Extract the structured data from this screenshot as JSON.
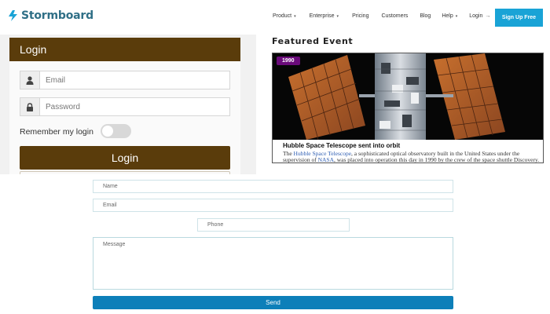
{
  "nav": {
    "logo_text": "Stormboard",
    "links": [
      {
        "label": "Product",
        "caret": "▾"
      },
      {
        "label": "Enterprise",
        "caret": "▾"
      },
      {
        "label": "Pricing",
        "caret": ""
      },
      {
        "label": "Customers",
        "caret": ""
      },
      {
        "label": "Blog",
        "caret": ""
      },
      {
        "label": "Help",
        "caret": "▾"
      },
      {
        "label": "Login",
        "caret": "→"
      }
    ],
    "signup_label": "Sign Up Free"
  },
  "login": {
    "title": "Login",
    "email_placeholder": "Email",
    "password_placeholder": "Password",
    "remember_label": "Remember my login",
    "button_label": "Login"
  },
  "featured": {
    "section_title": "Featured Event",
    "badge": "1990",
    "headline": "Hubble Space Telescope sent into orbit",
    "desc_pre": "The ",
    "desc_link1": "Hubble Space Telescope",
    "desc_mid": ", a sophisticated optical observatory built in the United States under the supervision of ",
    "desc_link2": "NASA",
    "desc_post": ", was placed into operation this day in 1990 by the crew of the space shuttle Discovery."
  },
  "contact": {
    "name_placeholder": "Name",
    "email_placeholder": "Email",
    "phone_placeholder": "Phone",
    "message_placeholder": "Message",
    "send_label": "Send"
  },
  "colors": {
    "brand_blue": "#19a3d6",
    "login_brown": "#5a3c0b",
    "badge_purple": "#6a0b7a",
    "send_blue": "#0d7fb9"
  }
}
